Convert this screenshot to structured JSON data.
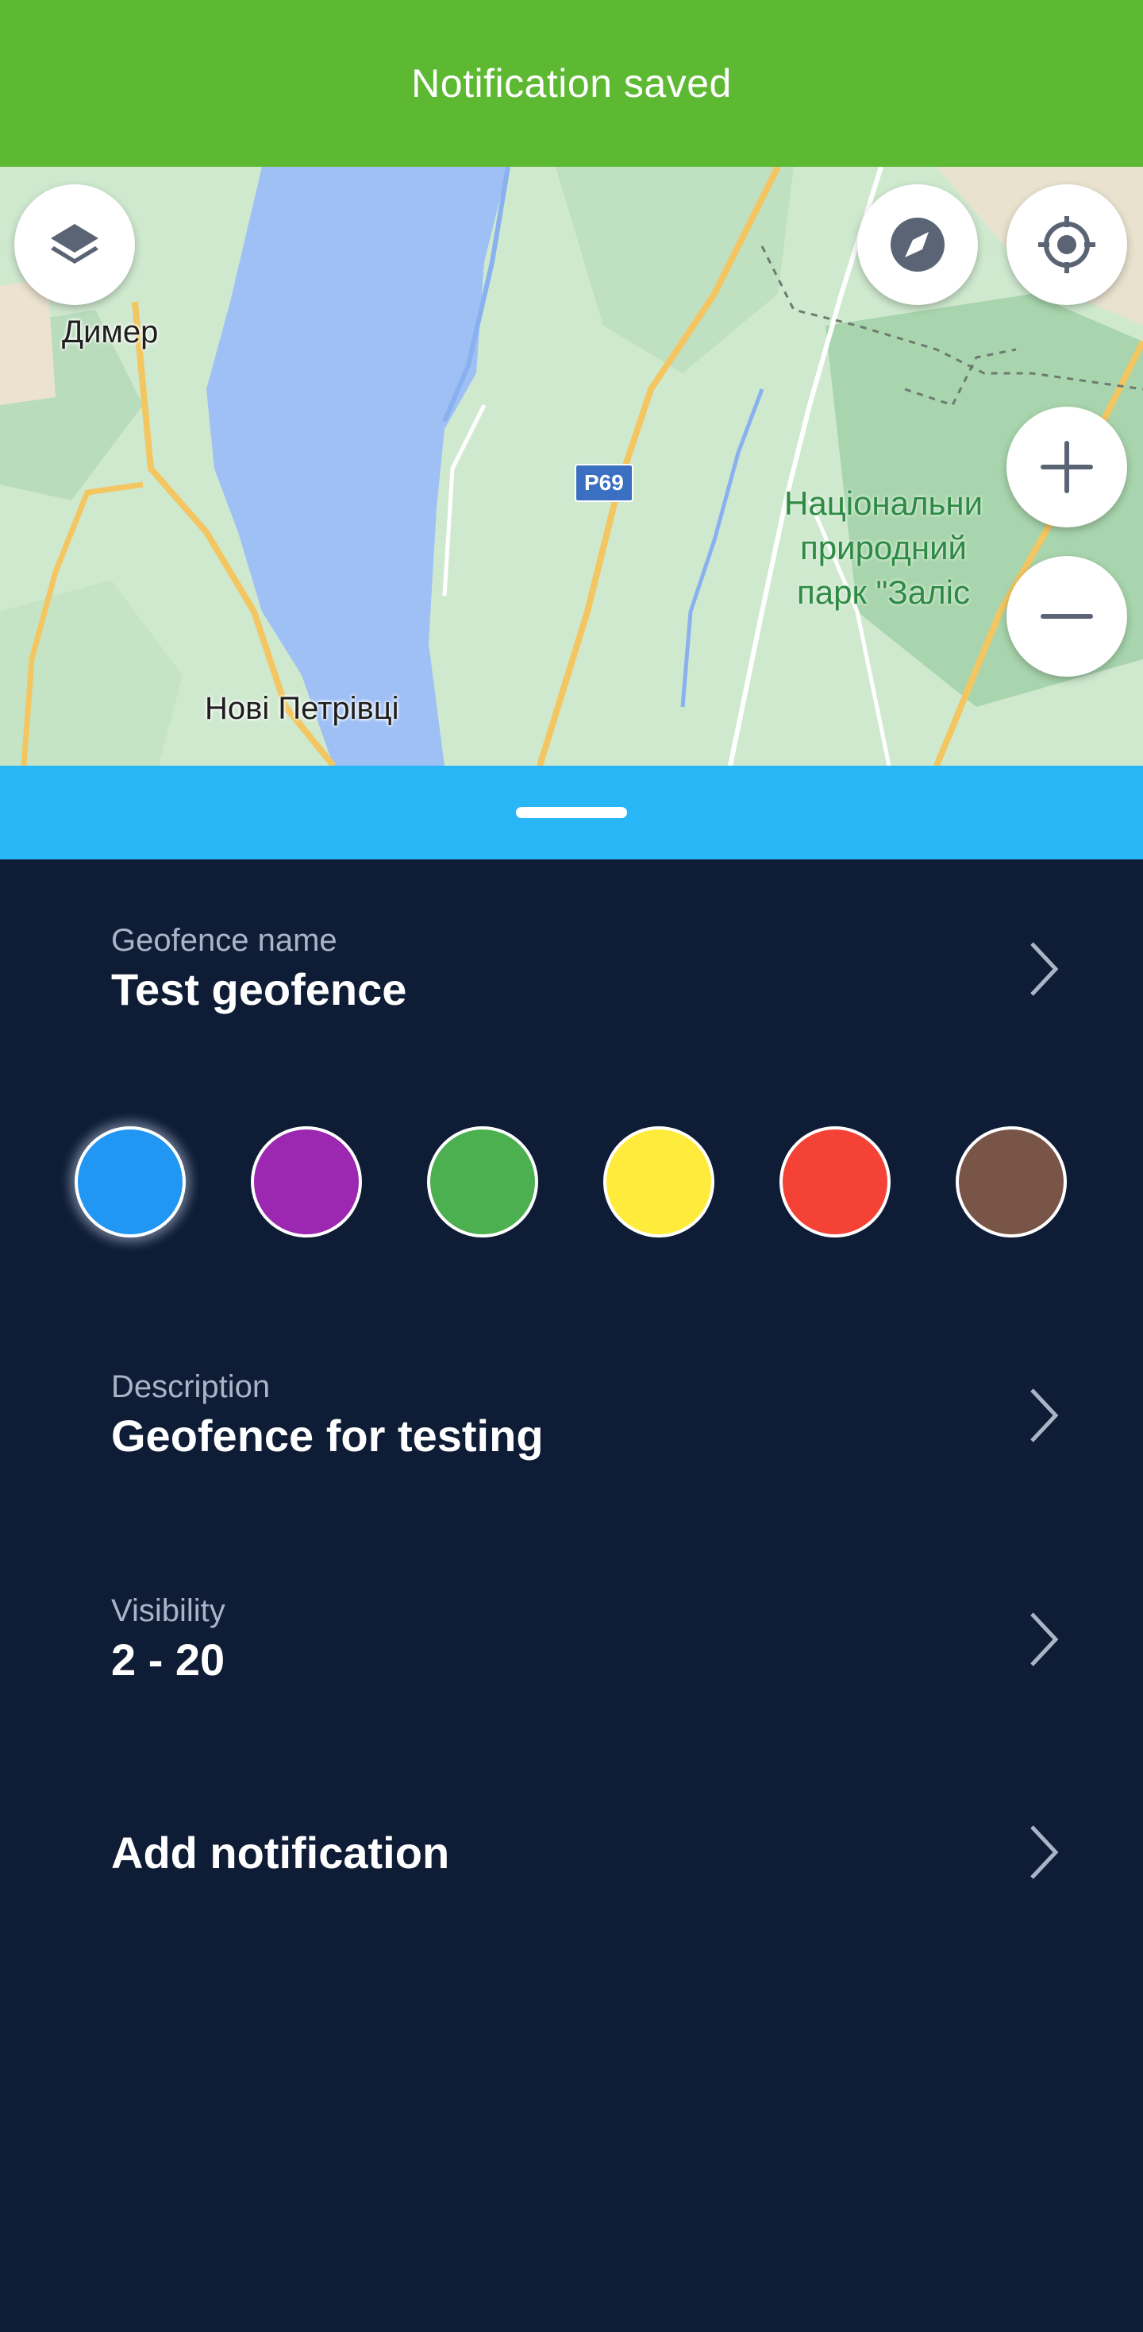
{
  "toast": {
    "message": "Notification saved",
    "color": "#5eb932"
  },
  "map": {
    "labels": {
      "town1": "Димер",
      "town2": "Нові Петрівці",
      "road": "P69",
      "park_line1": "Національни",
      "park_line2": "природний",
      "park_line3": "парк \"Заліс"
    },
    "buttons": {
      "layers": "layers-icon",
      "compass": "compass-icon",
      "locate": "crosshair-icon",
      "zoom_in": "plus-icon",
      "zoom_out": "minus-icon"
    }
  },
  "sheet": {
    "handle_color": "#29b6f6",
    "background": "#0e1c35",
    "geofence_name": {
      "label": "Geofence name",
      "value": "Test geofence"
    },
    "colors": [
      "#2196f3",
      "#9c27b0",
      "#4caf50",
      "#ffeb3b",
      "#f44336",
      "#795548"
    ],
    "selected_color_index": 0,
    "description": {
      "label": "Description",
      "value": "Geofence for testing"
    },
    "visibility": {
      "label": "Visibility",
      "value": "2 - 20"
    },
    "add_notification": {
      "value": "Add notification"
    }
  }
}
